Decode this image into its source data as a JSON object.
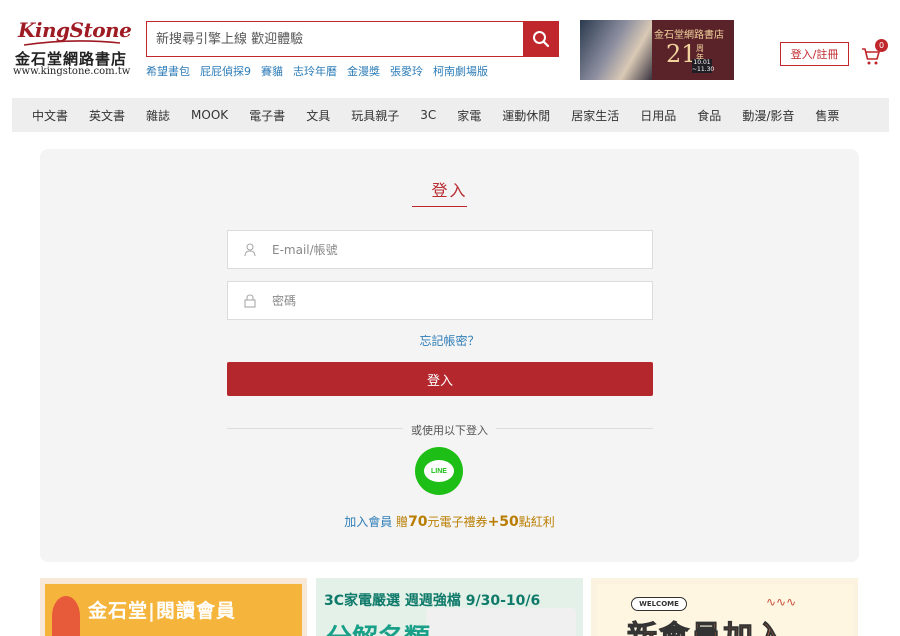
{
  "header": {
    "logo": {
      "brand": "KingStone",
      "name_cn": "金石堂網路書店",
      "url": "www.kingstone.com.tw"
    },
    "search": {
      "placeholder": "新搜尋引擎上線 歡迎體驗",
      "button_icon": "search-icon"
    },
    "hotwords": [
      "希望書包",
      "屁屁偵探9",
      "賽貓",
      "志玲年曆",
      "金漫獎",
      "張愛玲",
      "柯南劇場版"
    ],
    "banner": {
      "line1": "金石堂網路書店",
      "number": "21",
      "suffix": "周年慶",
      "dates": [
        "10.01",
        "~11.30"
      ]
    },
    "login_register": "登入/註冊",
    "cart": {
      "icon": "cart-icon",
      "count": "0"
    }
  },
  "nav": {
    "items": [
      "中文書",
      "英文書",
      "雜誌",
      "MOOK",
      "電子書",
      "文具",
      "玩具親子",
      "3C",
      "家電",
      "運動休閒",
      "居家生活",
      "日用品",
      "食品",
      "動漫/影音",
      "售票"
    ]
  },
  "login": {
    "title": "登入",
    "account_placeholder": "E-mail/帳號",
    "password_placeholder": "密碼",
    "forgot": "忘記帳密？",
    "submit": "登入",
    "alt_login": "或使用以下登入",
    "line_label": "LINE",
    "promo": {
      "join": "加入會員",
      "gift": "贈",
      "amount1": "70",
      "unit1": "元電子禮券",
      "plus": "+",
      "amount2": "50",
      "unit2": "點紅利"
    }
  },
  "promo_cards": [
    {
      "text": "金石堂|閱讀會員"
    },
    {
      "text": "3C家電嚴選 週週強檔 9/30-10/6",
      "big": "分解名類"
    },
    {
      "tag": "WELCOME",
      "big": "新會員加入"
    }
  ],
  "colors": {
    "brand_red": "#c0272d",
    "link_blue": "#2e7db8",
    "line_green": "#1dbf17",
    "promo_gold": "#b97d00"
  }
}
